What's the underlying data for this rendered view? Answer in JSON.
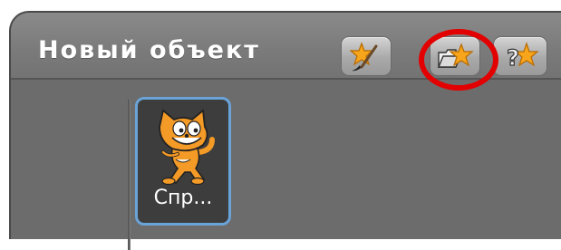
{
  "sprites_panel": {
    "title": "Новый объект",
    "buttons": [
      {
        "icon": "paint-new-sprite-icon"
      },
      {
        "icon": "choose-sprite-from-file-icon"
      },
      {
        "icon": "surprise-sprite-icon"
      }
    ],
    "highlight_color": "#e30000"
  },
  "sprite_list": {
    "items": [
      {
        "label": "Спр...",
        "selected": true,
        "selection_color": "#6aa3d8"
      }
    ]
  }
}
